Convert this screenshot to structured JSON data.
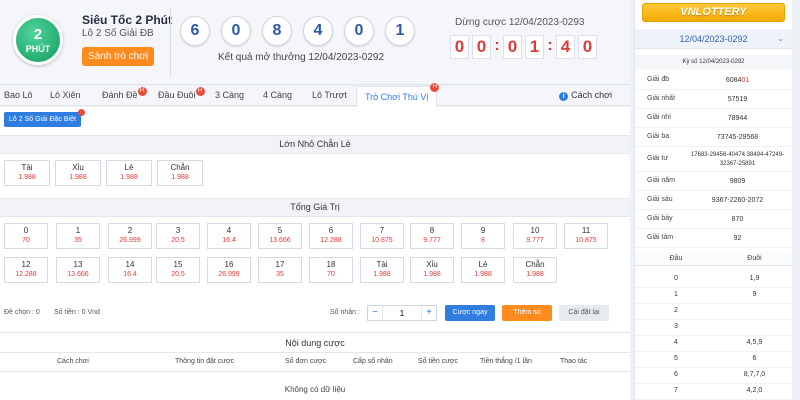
{
  "game": {
    "logo_number": "2",
    "logo_text": "PHÚT",
    "name": "Siêu Tốc 2 Phút",
    "subtitle": "Lô 2 Số Giải ĐB",
    "lobby_button": "Sảnh trò chơi"
  },
  "result": {
    "balls": [
      "6",
      "0",
      "8",
      "4",
      "0",
      "1"
    ],
    "label": "Kết quả mở thưởng 12/04/2023-0292"
  },
  "countdown": {
    "label": "Dừng cược 12/04/2023-0293",
    "digits": [
      "0",
      "0",
      "0",
      "1",
      "4",
      "0"
    ]
  },
  "tabs": [
    {
      "label": "Bao Lô",
      "hot": false
    },
    {
      "label": "Lô Xiên",
      "hot": false
    },
    {
      "label": "Đánh Đề",
      "hot": true
    },
    {
      "label": "Đầu Đuôi",
      "hot": true
    },
    {
      "label": "3 Càng",
      "hot": false
    },
    {
      "label": "4 Càng",
      "hot": false
    },
    {
      "label": "Lô Trượt",
      "hot": false
    },
    {
      "label": "Trò Chơi Thú Vị",
      "hot": true,
      "active": true
    }
  ],
  "hot_badge": "H",
  "howto_label": "Cách chơi",
  "info_glyph": "i",
  "subtab_label": "Lô 2 Số Giải Đặc Biệt",
  "section1_title": "Lớn Nhỏ Chẵn Lẻ",
  "size_bets": [
    {
      "label": "Tài",
      "odds": "1.988"
    },
    {
      "label": "Xỉu",
      "odds": "1.988"
    },
    {
      "label": "Lẻ",
      "odds": "1.988"
    },
    {
      "label": "Chẵn",
      "odds": "1.988"
    }
  ],
  "section2_title": "Tổng Giá Trị",
  "sum_row1": [
    {
      "label": "0",
      "odds": "70"
    },
    {
      "label": "1",
      "odds": "35"
    },
    {
      "label": "2",
      "odds": "26.999"
    },
    {
      "label": "3",
      "odds": "20.5"
    },
    {
      "label": "4",
      "odds": "16.4"
    },
    {
      "label": "5",
      "odds": "13.666"
    },
    {
      "label": "6",
      "odds": "12.288"
    },
    {
      "label": "7",
      "odds": "10.875"
    },
    {
      "label": "8",
      "odds": "9.777"
    },
    {
      "label": "9",
      "odds": "8"
    },
    {
      "label": "10",
      "odds": "9.777"
    },
    {
      "label": "11",
      "odds": "10.875"
    }
  ],
  "sum_row2": [
    {
      "label": "12",
      "odds": "12.288"
    },
    {
      "label": "13",
      "odds": "13.666"
    },
    {
      "label": "14",
      "odds": "16.4"
    },
    {
      "label": "15",
      "odds": "20.5"
    },
    {
      "label": "16",
      "odds": "26.999"
    },
    {
      "label": "17",
      "odds": "35"
    },
    {
      "label": "18",
      "odds": "70"
    },
    {
      "label": "Tài",
      "odds": "1.988"
    },
    {
      "label": "Xỉu",
      "odds": "1.988"
    },
    {
      "label": "Lẻ",
      "odds": "1.988"
    },
    {
      "label": "Chẵn",
      "odds": "1.988"
    }
  ],
  "controls": {
    "selected": "Đề chọn : 0",
    "amount": "Số tiền : 0 Vnd",
    "multiplier_label": "Số nhân :",
    "minus": "−",
    "plus": "+",
    "multiplier_value": "1",
    "bet_now": "Cược ngay",
    "add_slip": "Thêm số",
    "reset": "Cài đặt lại"
  },
  "bet_content_title": "Nội dung cược",
  "bet_table_headers": [
    "Cách chơi",
    "Thông tin đặt cược",
    "Số đơn cược",
    "Cấp số nhân",
    "Số tiền cược",
    "Tiền thắng /1 lần",
    "Thao tác"
  ],
  "empty_text": "Không có dữ liệu",
  "right_panel": {
    "brand": "VNLOTTERY",
    "date": "12/04/2023-0292",
    "chevron": "⌄",
    "draw_title": "Kỳ số 12/04/2023-0292",
    "prizes": [
      {
        "label": "Giải đb",
        "value_main": "6084",
        "value_hl": "01"
      },
      {
        "label": "Giải nhất",
        "value_main": "57519"
      },
      {
        "label": "Giải nhì",
        "value_main": "78944"
      },
      {
        "label": "Giải ba",
        "value_main": "73745-29568"
      },
      {
        "label": "Giải tư",
        "value_main": "17683-29456-40474 38494-47249-32367-25891"
      },
      {
        "label": "Giải năm",
        "value_main": "9809"
      },
      {
        "label": "Giải sáu",
        "value_main": "9367-2260-2072"
      },
      {
        "label": "Giải bảy",
        "value_main": "870"
      },
      {
        "label": "Giải tám",
        "value_main": "92"
      }
    ],
    "dt_head": [
      "Đầu",
      "Đuôi"
    ],
    "dt_rows": [
      [
        "0",
        "1,9"
      ],
      [
        "1",
        "9"
      ],
      [
        "2",
        ""
      ],
      [
        "3",
        ""
      ],
      [
        "4",
        "4,5,9"
      ],
      [
        "5",
        "6"
      ],
      [
        "6",
        "8,7,7,0"
      ],
      [
        "7",
        "4,2,0"
      ]
    ]
  },
  "colors": {
    "accent": "#2f7de1",
    "orange": "#ff8a1d",
    "red": "#e03b3b",
    "green": "#139c5f"
  }
}
